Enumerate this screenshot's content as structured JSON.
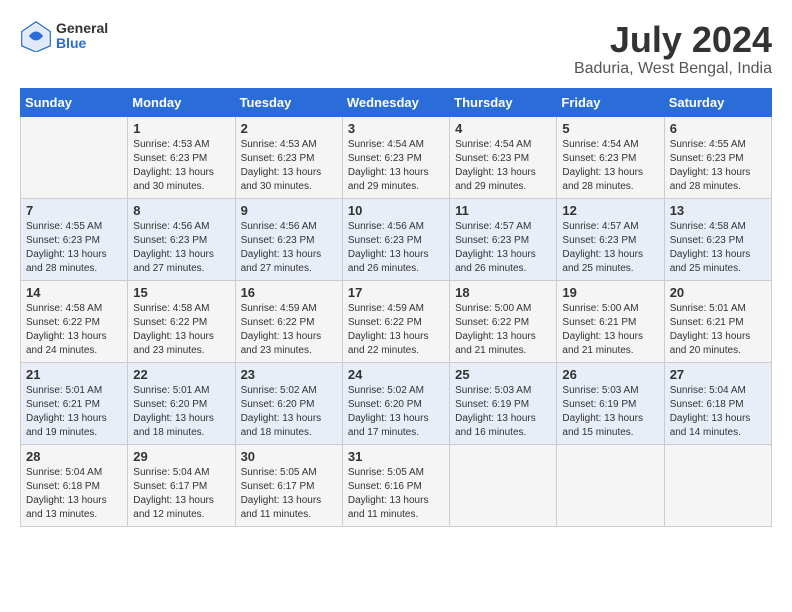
{
  "header": {
    "logo": {
      "general": "General",
      "blue": "Blue"
    },
    "title": "July 2024",
    "location": "Baduria, West Bengal, India"
  },
  "weekdays": [
    "Sunday",
    "Monday",
    "Tuesday",
    "Wednesday",
    "Thursday",
    "Friday",
    "Saturday"
  ],
  "weeks": [
    [
      {
        "day": "",
        "sunrise": "",
        "sunset": "",
        "daylight": ""
      },
      {
        "day": "1",
        "sunrise": "Sunrise: 4:53 AM",
        "sunset": "Sunset: 6:23 PM",
        "daylight": "Daylight: 13 hours and 30 minutes."
      },
      {
        "day": "2",
        "sunrise": "Sunrise: 4:53 AM",
        "sunset": "Sunset: 6:23 PM",
        "daylight": "Daylight: 13 hours and 30 minutes."
      },
      {
        "day": "3",
        "sunrise": "Sunrise: 4:54 AM",
        "sunset": "Sunset: 6:23 PM",
        "daylight": "Daylight: 13 hours and 29 minutes."
      },
      {
        "day": "4",
        "sunrise": "Sunrise: 4:54 AM",
        "sunset": "Sunset: 6:23 PM",
        "daylight": "Daylight: 13 hours and 29 minutes."
      },
      {
        "day": "5",
        "sunrise": "Sunrise: 4:54 AM",
        "sunset": "Sunset: 6:23 PM",
        "daylight": "Daylight: 13 hours and 28 minutes."
      },
      {
        "day": "6",
        "sunrise": "Sunrise: 4:55 AM",
        "sunset": "Sunset: 6:23 PM",
        "daylight": "Daylight: 13 hours and 28 minutes."
      }
    ],
    [
      {
        "day": "7",
        "sunrise": "Sunrise: 4:55 AM",
        "sunset": "Sunset: 6:23 PM",
        "daylight": "Daylight: 13 hours and 28 minutes."
      },
      {
        "day": "8",
        "sunrise": "Sunrise: 4:56 AM",
        "sunset": "Sunset: 6:23 PM",
        "daylight": "Daylight: 13 hours and 27 minutes."
      },
      {
        "day": "9",
        "sunrise": "Sunrise: 4:56 AM",
        "sunset": "Sunset: 6:23 PM",
        "daylight": "Daylight: 13 hours and 27 minutes."
      },
      {
        "day": "10",
        "sunrise": "Sunrise: 4:56 AM",
        "sunset": "Sunset: 6:23 PM",
        "daylight": "Daylight: 13 hours and 26 minutes."
      },
      {
        "day": "11",
        "sunrise": "Sunrise: 4:57 AM",
        "sunset": "Sunset: 6:23 PM",
        "daylight": "Daylight: 13 hours and 26 minutes."
      },
      {
        "day": "12",
        "sunrise": "Sunrise: 4:57 AM",
        "sunset": "Sunset: 6:23 PM",
        "daylight": "Daylight: 13 hours and 25 minutes."
      },
      {
        "day": "13",
        "sunrise": "Sunrise: 4:58 AM",
        "sunset": "Sunset: 6:23 PM",
        "daylight": "Daylight: 13 hours and 25 minutes."
      }
    ],
    [
      {
        "day": "14",
        "sunrise": "Sunrise: 4:58 AM",
        "sunset": "Sunset: 6:22 PM",
        "daylight": "Daylight: 13 hours and 24 minutes."
      },
      {
        "day": "15",
        "sunrise": "Sunrise: 4:58 AM",
        "sunset": "Sunset: 6:22 PM",
        "daylight": "Daylight: 13 hours and 23 minutes."
      },
      {
        "day": "16",
        "sunrise": "Sunrise: 4:59 AM",
        "sunset": "Sunset: 6:22 PM",
        "daylight": "Daylight: 13 hours and 23 minutes."
      },
      {
        "day": "17",
        "sunrise": "Sunrise: 4:59 AM",
        "sunset": "Sunset: 6:22 PM",
        "daylight": "Daylight: 13 hours and 22 minutes."
      },
      {
        "day": "18",
        "sunrise": "Sunrise: 5:00 AM",
        "sunset": "Sunset: 6:22 PM",
        "daylight": "Daylight: 13 hours and 21 minutes."
      },
      {
        "day": "19",
        "sunrise": "Sunrise: 5:00 AM",
        "sunset": "Sunset: 6:21 PM",
        "daylight": "Daylight: 13 hours and 21 minutes."
      },
      {
        "day": "20",
        "sunrise": "Sunrise: 5:01 AM",
        "sunset": "Sunset: 6:21 PM",
        "daylight": "Daylight: 13 hours and 20 minutes."
      }
    ],
    [
      {
        "day": "21",
        "sunrise": "Sunrise: 5:01 AM",
        "sunset": "Sunset: 6:21 PM",
        "daylight": "Daylight: 13 hours and 19 minutes."
      },
      {
        "day": "22",
        "sunrise": "Sunrise: 5:01 AM",
        "sunset": "Sunset: 6:20 PM",
        "daylight": "Daylight: 13 hours and 18 minutes."
      },
      {
        "day": "23",
        "sunrise": "Sunrise: 5:02 AM",
        "sunset": "Sunset: 6:20 PM",
        "daylight": "Daylight: 13 hours and 18 minutes."
      },
      {
        "day": "24",
        "sunrise": "Sunrise: 5:02 AM",
        "sunset": "Sunset: 6:20 PM",
        "daylight": "Daylight: 13 hours and 17 minutes."
      },
      {
        "day": "25",
        "sunrise": "Sunrise: 5:03 AM",
        "sunset": "Sunset: 6:19 PM",
        "daylight": "Daylight: 13 hours and 16 minutes."
      },
      {
        "day": "26",
        "sunrise": "Sunrise: 5:03 AM",
        "sunset": "Sunset: 6:19 PM",
        "daylight": "Daylight: 13 hours and 15 minutes."
      },
      {
        "day": "27",
        "sunrise": "Sunrise: 5:04 AM",
        "sunset": "Sunset: 6:18 PM",
        "daylight": "Daylight: 13 hours and 14 minutes."
      }
    ],
    [
      {
        "day": "28",
        "sunrise": "Sunrise: 5:04 AM",
        "sunset": "Sunset: 6:18 PM",
        "daylight": "Daylight: 13 hours and 13 minutes."
      },
      {
        "day": "29",
        "sunrise": "Sunrise: 5:04 AM",
        "sunset": "Sunset: 6:17 PM",
        "daylight": "Daylight: 13 hours and 12 minutes."
      },
      {
        "day": "30",
        "sunrise": "Sunrise: 5:05 AM",
        "sunset": "Sunset: 6:17 PM",
        "daylight": "Daylight: 13 hours and 11 minutes."
      },
      {
        "day": "31",
        "sunrise": "Sunrise: 5:05 AM",
        "sunset": "Sunset: 6:16 PM",
        "daylight": "Daylight: 13 hours and 11 minutes."
      },
      {
        "day": "",
        "sunrise": "",
        "sunset": "",
        "daylight": ""
      },
      {
        "day": "",
        "sunrise": "",
        "sunset": "",
        "daylight": ""
      },
      {
        "day": "",
        "sunrise": "",
        "sunset": "",
        "daylight": ""
      }
    ]
  ]
}
